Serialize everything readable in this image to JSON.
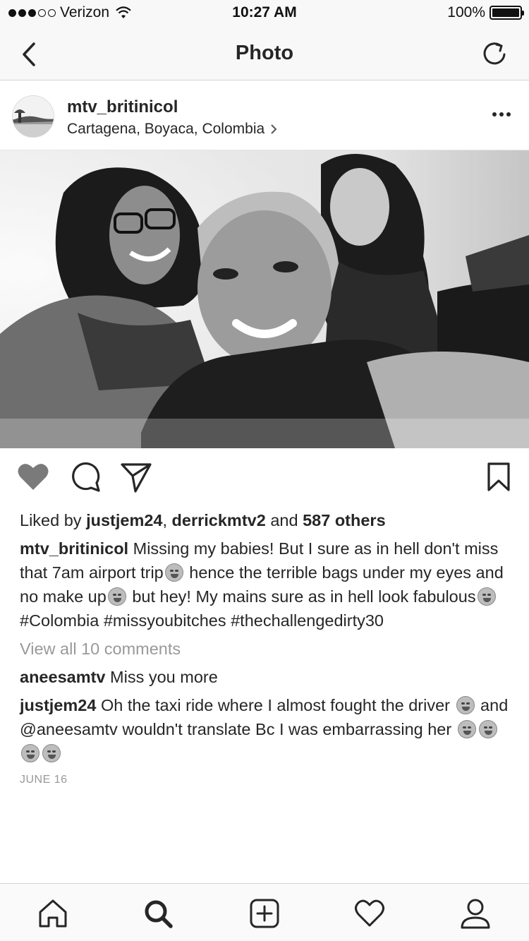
{
  "status_bar": {
    "carrier": "Verizon",
    "time": "10:27 AM",
    "battery": "100%"
  },
  "nav": {
    "title": "Photo",
    "back_icon": "chevron-left-icon",
    "refresh_icon": "refresh-icon"
  },
  "post": {
    "username": "mtv_britinicol",
    "location": "Cartagena, Boyaca, Colombia",
    "likes": {
      "prefix": "Liked by ",
      "user1": "justjem24",
      "sep": ", ",
      "user2": "derrickmtv2",
      "and": " and ",
      "others": "587 others"
    },
    "caption": {
      "author": "mtv_britinicol",
      "part1": " Missing my babies! But I sure as in hell don't miss that 7am airport trip",
      "part2": " hence the terrible bags under my eyes and no make up",
      "part3": " but hey! My mains sure as in hell look fabulous",
      "part4": " #Colombia #missyoubitches #thechallengedirty30"
    },
    "view_all": "View all 10 comments",
    "comments": [
      {
        "user": "aneesamtv",
        "text": " Miss you more"
      },
      {
        "user": "justjem24",
        "text1": " Oh the taxi ride where I almost fought  the driver ",
        "text2": "  and @aneesamtv wouldn't translate Bc I was embarrassing her "
      }
    ],
    "date": "JUNE 16"
  },
  "tab_bar": {
    "items": [
      "home-icon",
      "search-icon",
      "add-post-icon",
      "activity-heart-icon",
      "profile-icon"
    ]
  },
  "colors": {
    "text": "#262626",
    "muted": "#999999",
    "bar_bg": "#f8f8f8"
  }
}
